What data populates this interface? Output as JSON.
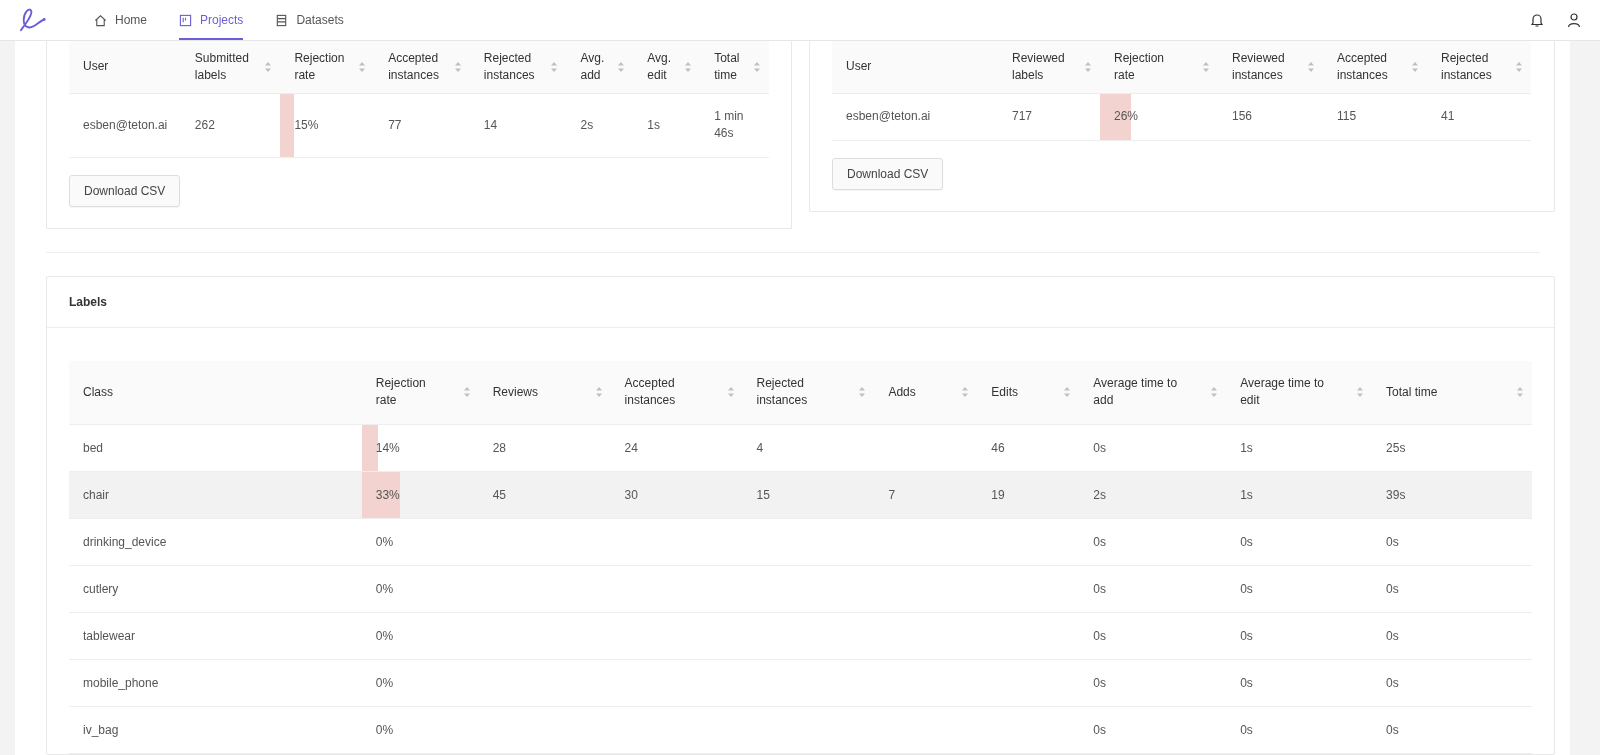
{
  "nav": {
    "items": [
      {
        "label": "Home",
        "selected": false
      },
      {
        "label": "Projects",
        "selected": true
      },
      {
        "label": "Datasets",
        "selected": false
      }
    ]
  },
  "submitted_table": {
    "columns": [
      {
        "label": "User",
        "sortable": false
      },
      {
        "label": "Submitted\nlabels",
        "sortable": true
      },
      {
        "label": "Rejection\nrate",
        "sortable": true
      },
      {
        "label": "Accepted\ninstances",
        "sortable": true
      },
      {
        "label": "Rejected\ninstances",
        "sortable": true
      },
      {
        "label": "Avg.\nadd",
        "sortable": true
      },
      {
        "label": "Avg.\nedit",
        "sortable": true
      },
      {
        "label": "Total\ntime",
        "sortable": true
      }
    ],
    "rows": [
      {
        "cells": [
          "esben@teton.ai",
          "262",
          "15%",
          "77",
          "14",
          "2s",
          "1s",
          "1 min\n46s"
        ],
        "level": 0.15
      }
    ],
    "button": "Download CSV"
  },
  "review_table": {
    "columns": [
      {
        "label": "User",
        "sortable": false
      },
      {
        "label": "Reviewed\nlabels",
        "sortable": true
      },
      {
        "label": "Rejection\nrate",
        "sortable": true
      },
      {
        "label": "Reviewed\ninstances",
        "sortable": true
      },
      {
        "label": "Accepted\ninstances",
        "sortable": true
      },
      {
        "label": "Rejected\ninstances",
        "sortable": true
      }
    ],
    "rows": [
      {
        "cells": [
          "esben@teton.ai",
          "717",
          "26%",
          "156",
          "115",
          "41"
        ],
        "level": 0.26
      }
    ],
    "button": "Download CSV"
  },
  "labels": {
    "title": "Labels",
    "columns": [
      {
        "label": "Class",
        "sortable": false
      },
      {
        "label": "Rejection\nrate",
        "sortable": true
      },
      {
        "label": "Reviews",
        "sortable": true
      },
      {
        "label": "Accepted\ninstances",
        "sortable": true
      },
      {
        "label": "Rejected\ninstances",
        "sortable": true
      },
      {
        "label": "Adds",
        "sortable": true
      },
      {
        "label": "Edits",
        "sortable": true
      },
      {
        "label": "Average time to\nadd",
        "sortable": true
      },
      {
        "label": "Average time to\nedit",
        "sortable": true
      },
      {
        "label": "Total time",
        "sortable": true
      }
    ],
    "rows": [
      {
        "cells": [
          "bed",
          "14%",
          "28",
          "24",
          "4",
          null,
          "46",
          "0s",
          "1s",
          "25s"
        ],
        "level": 0.14,
        "highlighted": false
      },
      {
        "cells": [
          "chair",
          "33%",
          "45",
          "30",
          "15",
          "7",
          "19",
          "2s",
          "1s",
          "39s"
        ],
        "level": 0.33,
        "highlighted": true
      },
      {
        "cells": [
          "drinking_device",
          "0%",
          null,
          null,
          null,
          null,
          null,
          "0s",
          "0s",
          "0s"
        ],
        "level": 0,
        "highlighted": false
      },
      {
        "cells": [
          "cutlery",
          "0%",
          null,
          null,
          null,
          null,
          null,
          "0s",
          "0s",
          "0s"
        ],
        "level": 0,
        "highlighted": false
      },
      {
        "cells": [
          "tablewear",
          "0%",
          null,
          null,
          null,
          null,
          null,
          "0s",
          "0s",
          "0s"
        ],
        "level": 0,
        "highlighted": false
      },
      {
        "cells": [
          "mobile_phone",
          "0%",
          null,
          null,
          null,
          null,
          null,
          "0s",
          "0s",
          "0s"
        ],
        "level": 0,
        "highlighted": false
      },
      {
        "cells": [
          "iv_bag",
          "0%",
          null,
          null,
          null,
          null,
          null,
          "0s",
          "0s",
          "0s"
        ],
        "level": 0,
        "highlighted": false
      }
    ]
  }
}
